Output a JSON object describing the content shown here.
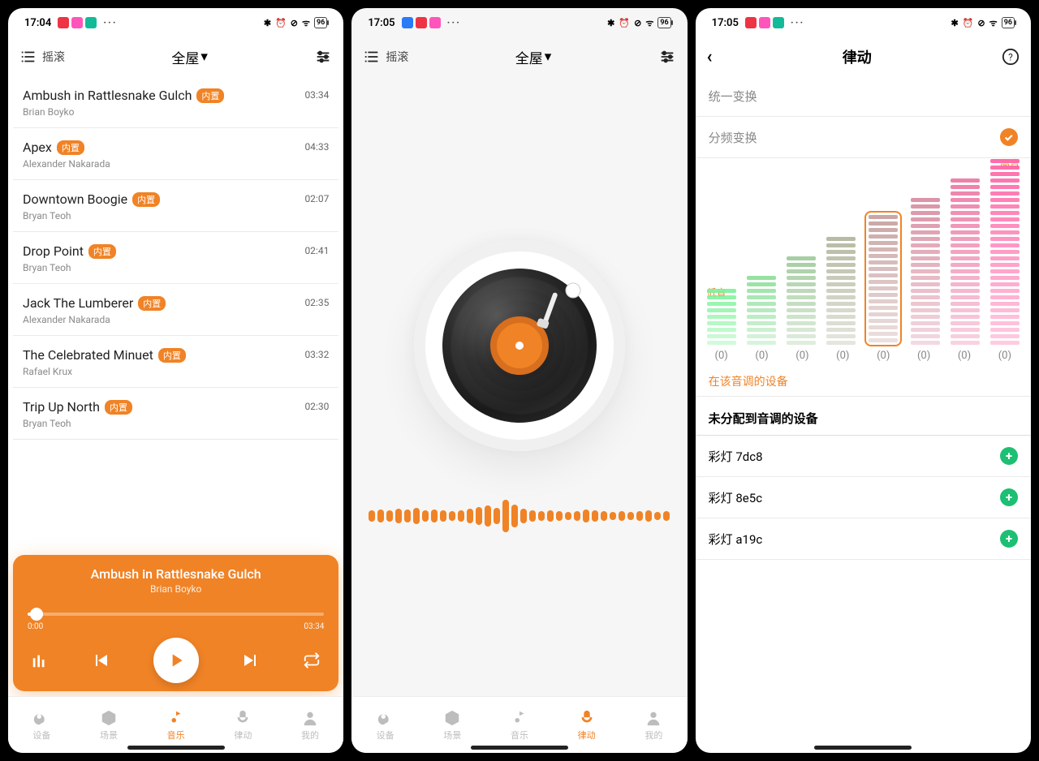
{
  "status": {
    "time1": "17:04",
    "time2": "17:05",
    "time3": "17:05",
    "battery": "96",
    "dots": "···"
  },
  "headers": {
    "category": "摇滚",
    "room": "全屋",
    "rhythm_title": "律动"
  },
  "tracks": [
    {
      "title": "Ambush in Rattlesnake Gulch",
      "artist": "Brian Boyko",
      "badge": "内置",
      "dur": "03:34"
    },
    {
      "title": "Apex",
      "artist": "Alexander Nakarada",
      "badge": "内置",
      "dur": "04:33"
    },
    {
      "title": "Downtown Boogie",
      "artist": "Bryan Teoh",
      "badge": "内置",
      "dur": "02:07"
    },
    {
      "title": "Drop Point",
      "artist": "Bryan Teoh",
      "badge": "内置",
      "dur": "02:41"
    },
    {
      "title": "Jack The Lumberer",
      "artist": "Alexander Nakarada",
      "badge": "内置",
      "dur": "02:35"
    },
    {
      "title": "The Celebrated Minuet",
      "artist": "Rafael Krux",
      "badge": "内置",
      "dur": "03:32"
    },
    {
      "title": "Trip Up North",
      "artist": "Bryan Teoh",
      "badge": "内置",
      "dur": "02:30"
    }
  ],
  "nowplaying": {
    "title": "Ambush in Rattlesnake Gulch",
    "artist": "Brian Boyko",
    "elapsed": "0:00",
    "total": "03:34"
  },
  "tabs": [
    "设备",
    "场景",
    "音乐",
    "律动",
    "我的"
  ],
  "p3": {
    "mode_unified": "统一变换",
    "mode_split": "分频变换",
    "low": "低音",
    "high": "高音",
    "zero": "(0)",
    "on_tone": "在该音调的设备",
    "unassigned_title": "未分配到音调的设备",
    "devices": [
      "彩灯 7dc8",
      "彩灯 8e5c",
      "彩灯 a19c"
    ]
  },
  "chart_data": {
    "type": "bar",
    "note": "Audio frequency band equalizer – 8 bands, each shows device count; all zero.",
    "bands": 8,
    "selected_index": 4,
    "labels": [
      "(0)",
      "(0)",
      "(0)",
      "(0)",
      "(0)",
      "(0)",
      "(0)",
      "(0)"
    ],
    "values": [
      0,
      0,
      0,
      0,
      0,
      0,
      0,
      0
    ],
    "segment_heights": [
      9,
      11,
      14,
      17,
      20,
      23,
      26,
      29
    ],
    "low_label": "低音",
    "high_label": "高音",
    "gradient_start": "#7ef29a",
    "gradient_end": "#ff6aa9"
  },
  "wave_heights": [
    14,
    16,
    14,
    18,
    16,
    20,
    14,
    16,
    14,
    12,
    14,
    18,
    22,
    26,
    20,
    40,
    28,
    18,
    14,
    12,
    14,
    12,
    10,
    12,
    16,
    14,
    12,
    10,
    12,
    10,
    12,
    14,
    10,
    12
  ]
}
